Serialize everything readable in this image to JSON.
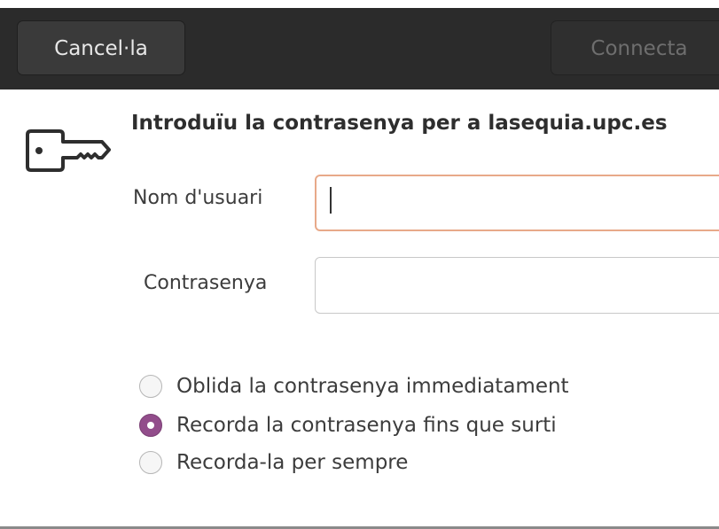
{
  "header": {
    "cancel_label": "Cancel·la",
    "connect_label": "Connecta"
  },
  "dialog": {
    "icon": "key-icon",
    "title": "Introduïu la contrasenya per a lasequia.upc.es",
    "username_label": "Nom d'usuari",
    "username_value": "",
    "password_label": "Contrasenya",
    "password_value": "",
    "options": [
      {
        "label": "Oblida la contrasenya immediatament",
        "selected": false
      },
      {
        "label": "Recorda la contrasenya fins que surti",
        "selected": true
      },
      {
        "label": "Recorda-la per sempre",
        "selected": false
      }
    ]
  },
  "colors": {
    "headerbar": "#2b2b2b",
    "accent_radio": "#924d8b",
    "focus_border": "#e8a989"
  }
}
